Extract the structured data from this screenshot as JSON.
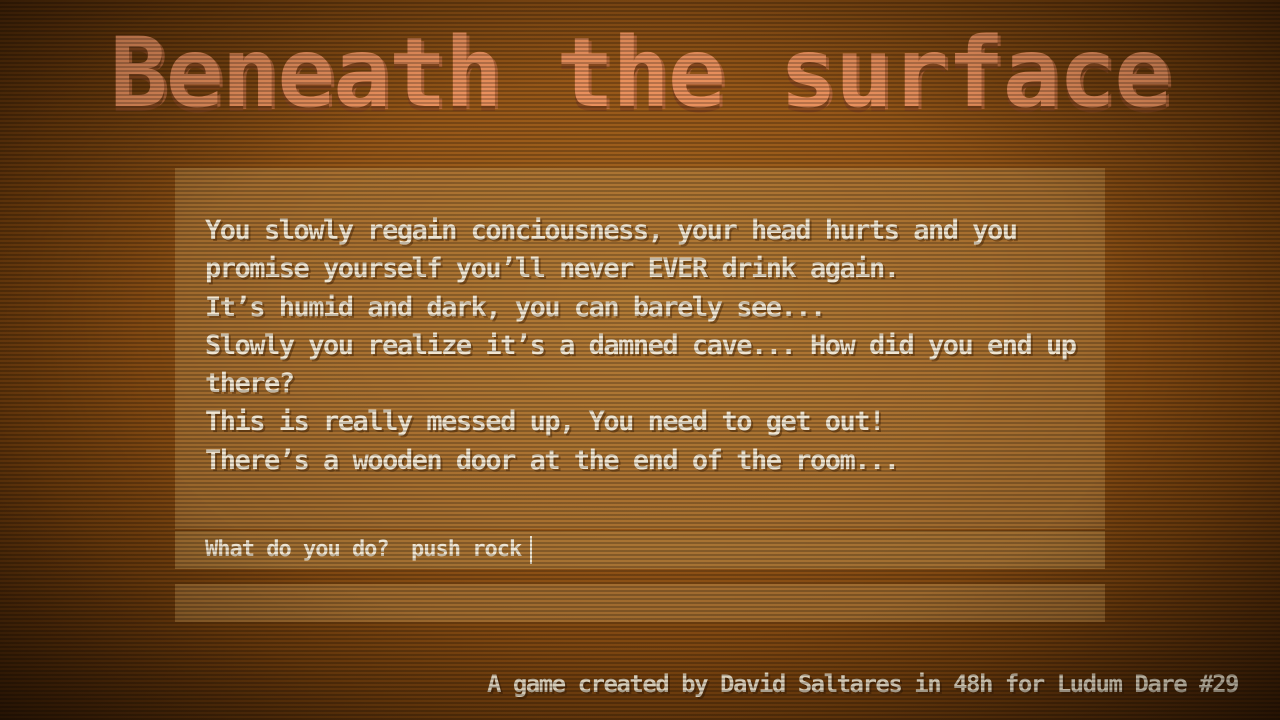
{
  "game": {
    "title": "Beneath the surface"
  },
  "story": {
    "text": "You slowly regain conciousness, your head hurts and you\npromise yourself you’ll never EVER drink again.\nIt’s humid and dark, you can barely see...\nSlowly you realize it’s a damned cave... How did you end up\nthere?\nThis is really messed up, You need to get out!\nThere’s a wooden door at the end of the room..."
  },
  "command": {
    "prompt": "What do you do?",
    "value": "push rock"
  },
  "footer": {
    "credits": "A game created by David Saltares in 48h for Ludum Dare #29"
  },
  "colors": {
    "background": "#965718",
    "title": "#e9905c",
    "text": "#f1e6d2"
  }
}
